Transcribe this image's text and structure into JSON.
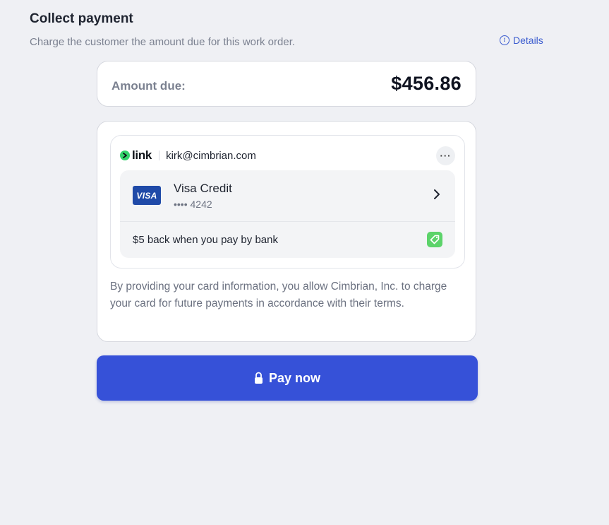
{
  "header": {
    "title": "Collect payment",
    "subtitle": "Charge the customer the amount due for this work order.",
    "details_label": "Details",
    "details_icon": "info-icon"
  },
  "amount": {
    "label": "Amount due:",
    "value": "$456.86"
  },
  "link": {
    "logo_text": "link",
    "logo_icon": "link-logo-icon",
    "email": "kirk@cimbrian.com",
    "more_label": "···"
  },
  "card": {
    "brand": "VISA",
    "name": "Visa Credit",
    "number": "•••• 4242"
  },
  "promo": {
    "text": "$5 back when you pay by bank",
    "icon": "tag-icon"
  },
  "consent": "By providing your card information, you allow Cimbrian, Inc. to charge your card for future payments in accordance with their terms.",
  "pay_button": {
    "label": "Pay now",
    "icon": "lock-icon"
  },
  "colors": {
    "accent": "#3651d8",
    "link_green": "#33d46b",
    "visa_blue": "#1f4aa8",
    "page_background": "#eff0f4"
  }
}
